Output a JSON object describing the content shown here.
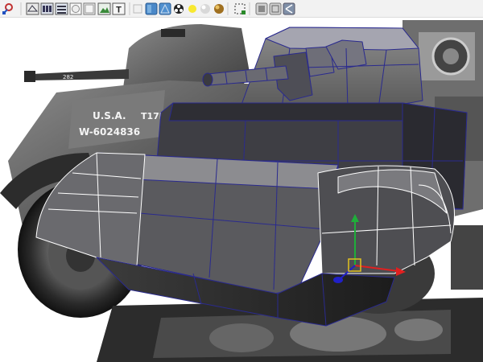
{
  "toolbar": {
    "buttons": [
      {
        "name": "snap-magnet-icon"
      },
      {
        "name": "wireframe-shading-icon"
      },
      {
        "name": "smooth-shading-icon"
      },
      {
        "name": "flat-shading-icon"
      },
      {
        "name": "isolate-select-icon"
      },
      {
        "name": "xray-icon"
      },
      {
        "name": "image-plane-icon"
      },
      {
        "name": "text-tool-icon",
        "label": "T"
      },
      {
        "name": "default-material-icon"
      },
      {
        "name": "textured-icon"
      },
      {
        "name": "wire-on-shaded-icon"
      },
      {
        "name": "use-lights-icon"
      },
      {
        "name": "light-bulb-icon"
      },
      {
        "name": "sphere-shading-icon"
      },
      {
        "name": "shadows-icon"
      },
      {
        "name": "select-region-icon"
      },
      {
        "name": "camera-view-icon"
      },
      {
        "name": "grid-view-icon"
      },
      {
        "name": "share-icon"
      }
    ]
  },
  "viewport": {
    "reference_markings": [
      "U.S.A.",
      "W-6024836",
      "T17El",
      "282"
    ],
    "colors": {
      "wire": "#2a2a8e",
      "mesh_highlight": "#ffffff",
      "axis_y": "#1fae3a",
      "axis_x": "#e02020",
      "axis_z": "#2020c8",
      "pivot": "#e0c020"
    }
  }
}
